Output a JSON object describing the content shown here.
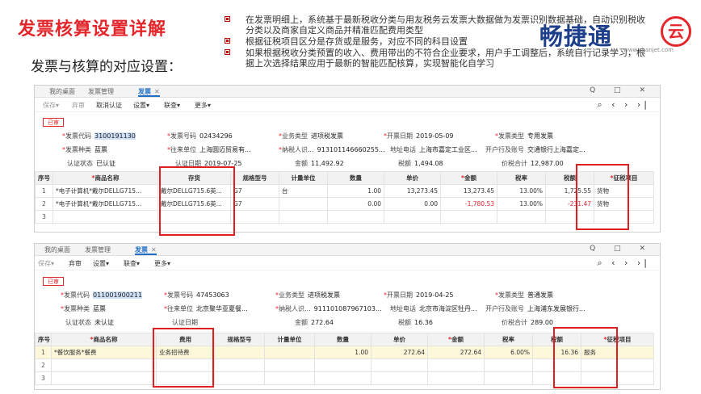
{
  "title": "发票核算设置详解",
  "subtitle": "发票与核算的对应设置：",
  "bullets": [
    "在发票明细上，系统基于最新税收分类与用友税务云发票大数据做为发票识别数据基础，自动识别税收分类以及商家自定义商品并精准匹配费用类型",
    "根据征税项目区分是存货或是服务，对应不同的科目设置",
    "如果根据税收分类预置的收入、费用带出的不符合企业要求，用户手工调整后，系统自行记录学习，根据上次选择结果应用于最新的智能匹配核算，实现智能化自学习"
  ],
  "logo": {
    "text": "畅捷通",
    "circle": "云",
    "url": "www.chanjet.com"
  },
  "win1": {
    "tabs": [
      "我的桌面",
      "发票管理",
      "发票"
    ],
    "window_controls": "Q □ ✕",
    "toolbar": [
      "保存▾",
      "弃审",
      "取消认证",
      "设置▾",
      "联查▾",
      "更多▾"
    ],
    "nav": "⌕ ‹ › ›|",
    "badge": "已审",
    "fields": {
      "invoice_code_label": "发票代码",
      "invoice_code": "3100191130",
      "invoice_no_label": "发票号码",
      "invoice_no": "02434296",
      "biz_type_label": "业务类型",
      "biz_type": "进项税发票",
      "open_date_label": "开票日期",
      "open_date": "2019-05-09",
      "inv_type_label": "发票类型",
      "inv_type": "专用发票",
      "inv_kind_label": "发票种类",
      "inv_kind": "蓝票",
      "partner_label": "往来单位",
      "partner": "上海圆迈贸易有...",
      "taxpayer_label": "纳税人识...",
      "taxpayer": "913101146660255...",
      "address_label": "地址电话",
      "address": "上海市嘉定工业区...",
      "bank_label": "开户行及账号",
      "bank": "交通银行上海嘉定...",
      "cert_status_label": "认证状态",
      "cert_status": "已认证",
      "cert_date_label": "认证日期",
      "cert_date": "2019-07-25",
      "amount_label": "金额",
      "amount": "11,492.92",
      "tax_label": "税额",
      "tax": "1,494.08",
      "total_label": "价税合计",
      "total": "12,987.00"
    },
    "table": {
      "headers": [
        "序号",
        "商品名称",
        "存货",
        "规格型号",
        "计量单位",
        "数量",
        "单价",
        "金额",
        "税率",
        "税额",
        "征税项目"
      ],
      "rows": [
        [
          "1",
          "*电子计算机*戴尔DELLG715...",
          "戴尔DELLG715.6英...",
          "G7",
          "台",
          "1.00",
          "13,273.45",
          "13,273.45",
          "13.00%",
          "1,725.55",
          "货物"
        ],
        [
          "2",
          "*电子计算机*戴尔DELLG715...",
          "戴尔DELLG715.6英...",
          "G7",
          "",
          "0.00",
          "0.00",
          "-1,780.53",
          "13.00%",
          "-231.47",
          "货物"
        ],
        [
          "3",
          "",
          "",
          "",
          "",
          "",
          "",
          "",
          "",
          "",
          ""
        ]
      ]
    }
  },
  "win2": {
    "tabs": [
      "我的桌面",
      "发票管理",
      "发票"
    ],
    "window_controls": "Q □ ✕",
    "toolbar": [
      "保存▾",
      "弃审",
      "设置▾",
      "联查▾",
      "更多▾"
    ],
    "nav": "⌕ ‹ › ›|",
    "badge": "已审",
    "fields": {
      "invoice_code_label": "发票代码",
      "invoice_code": "011001900211",
      "invoice_no_label": "发票号码",
      "invoice_no": "47453063",
      "biz_type_label": "业务类型",
      "biz_type": "进项税发票",
      "open_date_label": "开票日期",
      "open_date": "2019-04-25",
      "inv_type_label": "发票类型",
      "inv_type": "普通发票",
      "inv_kind_label": "发票种类",
      "inv_kind": "蓝票",
      "partner_label": "往来单位",
      "partner": "北京聚华亚夏餐...",
      "taxpayer_label": "纳税人识...",
      "taxpayer": "911101087967103...",
      "address_label": "地址电话",
      "address": "北京市海淀区牡丹...",
      "bank_label": "开户行及账号",
      "bank": "上海浦东发展银行...",
      "cert_status_label": "认证状态",
      "cert_status": "未认证",
      "cert_date_label": "认证日期",
      "cert_date": "",
      "amount_label": "金额",
      "amount": "272.64",
      "tax_label": "税额",
      "tax": "16.36",
      "total_label": "价税合计",
      "total": "289.00"
    },
    "table": {
      "headers": [
        "序号",
        "商品名称",
        "费用",
        "规格型号",
        "计量单位",
        "数量",
        "单价",
        "金额",
        "税率",
        "税额",
        "征税项目"
      ],
      "rows": [
        [
          "1",
          "*餐饮服务*餐费",
          "业务招待费",
          "",
          "",
          "1.00",
          "272.64",
          "272.64",
          "6.00%",
          "16.36",
          "服务"
        ],
        [
          "2",
          "",
          "",
          "",
          "",
          "",
          "",
          "",
          "",
          "",
          ""
        ],
        [
          "3",
          "",
          "",
          "",
          "",
          "",
          "",
          "",
          "",
          "",
          ""
        ]
      ]
    }
  }
}
